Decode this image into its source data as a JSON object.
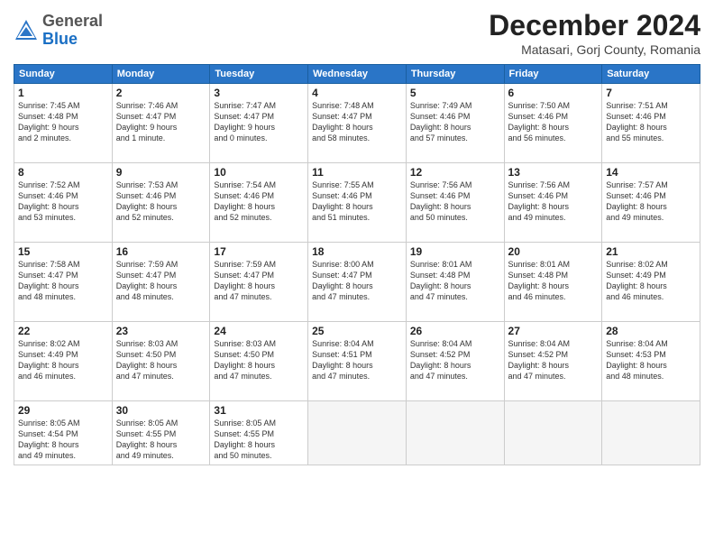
{
  "header": {
    "logo_general": "General",
    "logo_blue": "Blue",
    "month_title": "December 2024",
    "location": "Matasari, Gorj County, Romania"
  },
  "calendar": {
    "days_of_week": [
      "Sunday",
      "Monday",
      "Tuesday",
      "Wednesday",
      "Thursday",
      "Friday",
      "Saturday"
    ],
    "weeks": [
      [
        {
          "day": 1,
          "info": "Sunrise: 7:45 AM\nSunset: 4:48 PM\nDaylight: 9 hours\nand 2 minutes."
        },
        {
          "day": 2,
          "info": "Sunrise: 7:46 AM\nSunset: 4:47 PM\nDaylight: 9 hours\nand 1 minute."
        },
        {
          "day": 3,
          "info": "Sunrise: 7:47 AM\nSunset: 4:47 PM\nDaylight: 9 hours\nand 0 minutes."
        },
        {
          "day": 4,
          "info": "Sunrise: 7:48 AM\nSunset: 4:47 PM\nDaylight: 8 hours\nand 58 minutes."
        },
        {
          "day": 5,
          "info": "Sunrise: 7:49 AM\nSunset: 4:46 PM\nDaylight: 8 hours\nand 57 minutes."
        },
        {
          "day": 6,
          "info": "Sunrise: 7:50 AM\nSunset: 4:46 PM\nDaylight: 8 hours\nand 56 minutes."
        },
        {
          "day": 7,
          "info": "Sunrise: 7:51 AM\nSunset: 4:46 PM\nDaylight: 8 hours\nand 55 minutes."
        }
      ],
      [
        {
          "day": 8,
          "info": "Sunrise: 7:52 AM\nSunset: 4:46 PM\nDaylight: 8 hours\nand 53 minutes."
        },
        {
          "day": 9,
          "info": "Sunrise: 7:53 AM\nSunset: 4:46 PM\nDaylight: 8 hours\nand 52 minutes."
        },
        {
          "day": 10,
          "info": "Sunrise: 7:54 AM\nSunset: 4:46 PM\nDaylight: 8 hours\nand 52 minutes."
        },
        {
          "day": 11,
          "info": "Sunrise: 7:55 AM\nSunset: 4:46 PM\nDaylight: 8 hours\nand 51 minutes."
        },
        {
          "day": 12,
          "info": "Sunrise: 7:56 AM\nSunset: 4:46 PM\nDaylight: 8 hours\nand 50 minutes."
        },
        {
          "day": 13,
          "info": "Sunrise: 7:56 AM\nSunset: 4:46 PM\nDaylight: 8 hours\nand 49 minutes."
        },
        {
          "day": 14,
          "info": "Sunrise: 7:57 AM\nSunset: 4:46 PM\nDaylight: 8 hours\nand 49 minutes."
        }
      ],
      [
        {
          "day": 15,
          "info": "Sunrise: 7:58 AM\nSunset: 4:47 PM\nDaylight: 8 hours\nand 48 minutes."
        },
        {
          "day": 16,
          "info": "Sunrise: 7:59 AM\nSunset: 4:47 PM\nDaylight: 8 hours\nand 48 minutes."
        },
        {
          "day": 17,
          "info": "Sunrise: 7:59 AM\nSunset: 4:47 PM\nDaylight: 8 hours\nand 47 minutes."
        },
        {
          "day": 18,
          "info": "Sunrise: 8:00 AM\nSunset: 4:47 PM\nDaylight: 8 hours\nand 47 minutes."
        },
        {
          "day": 19,
          "info": "Sunrise: 8:01 AM\nSunset: 4:48 PM\nDaylight: 8 hours\nand 47 minutes."
        },
        {
          "day": 20,
          "info": "Sunrise: 8:01 AM\nSunset: 4:48 PM\nDaylight: 8 hours\nand 46 minutes."
        },
        {
          "day": 21,
          "info": "Sunrise: 8:02 AM\nSunset: 4:49 PM\nDaylight: 8 hours\nand 46 minutes."
        }
      ],
      [
        {
          "day": 22,
          "info": "Sunrise: 8:02 AM\nSunset: 4:49 PM\nDaylight: 8 hours\nand 46 minutes."
        },
        {
          "day": 23,
          "info": "Sunrise: 8:03 AM\nSunset: 4:50 PM\nDaylight: 8 hours\nand 47 minutes."
        },
        {
          "day": 24,
          "info": "Sunrise: 8:03 AM\nSunset: 4:50 PM\nDaylight: 8 hours\nand 47 minutes."
        },
        {
          "day": 25,
          "info": "Sunrise: 8:04 AM\nSunset: 4:51 PM\nDaylight: 8 hours\nand 47 minutes."
        },
        {
          "day": 26,
          "info": "Sunrise: 8:04 AM\nSunset: 4:52 PM\nDaylight: 8 hours\nand 47 minutes."
        },
        {
          "day": 27,
          "info": "Sunrise: 8:04 AM\nSunset: 4:52 PM\nDaylight: 8 hours\nand 47 minutes."
        },
        {
          "day": 28,
          "info": "Sunrise: 8:04 AM\nSunset: 4:53 PM\nDaylight: 8 hours\nand 48 minutes."
        }
      ],
      [
        {
          "day": 29,
          "info": "Sunrise: 8:05 AM\nSunset: 4:54 PM\nDaylight: 8 hours\nand 49 minutes."
        },
        {
          "day": 30,
          "info": "Sunrise: 8:05 AM\nSunset: 4:55 PM\nDaylight: 8 hours\nand 49 minutes."
        },
        {
          "day": 31,
          "info": "Sunrise: 8:05 AM\nSunset: 4:55 PM\nDaylight: 8 hours\nand 50 minutes."
        },
        {
          "day": null,
          "info": ""
        },
        {
          "day": null,
          "info": ""
        },
        {
          "day": null,
          "info": ""
        },
        {
          "day": null,
          "info": ""
        }
      ]
    ]
  }
}
